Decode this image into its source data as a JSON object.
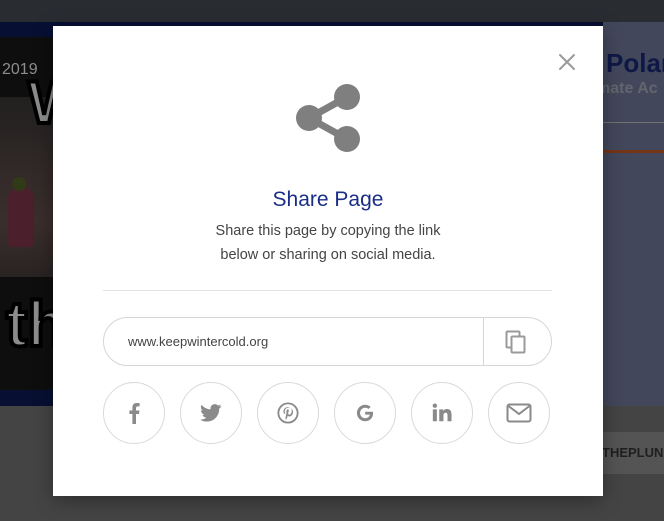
{
  "background": {
    "video_year": "2019",
    "video_big_letter": "W",
    "video_bottom_text": "th",
    "page_title_partial": "Polar",
    "page_subtitle_partial": "mate Ac",
    "footer_tag_partial": "THEPLUN"
  },
  "modal": {
    "title": "Share Page",
    "description": "Share this page by copying the link below or sharing on social media.",
    "link_value": "www.keepwintercold.org",
    "share_buttons": [
      "facebook",
      "twitter",
      "pinterest",
      "google",
      "linkedin",
      "email"
    ],
    "icon_color": "#7f7f7f",
    "title_color": "#1a2e86"
  }
}
